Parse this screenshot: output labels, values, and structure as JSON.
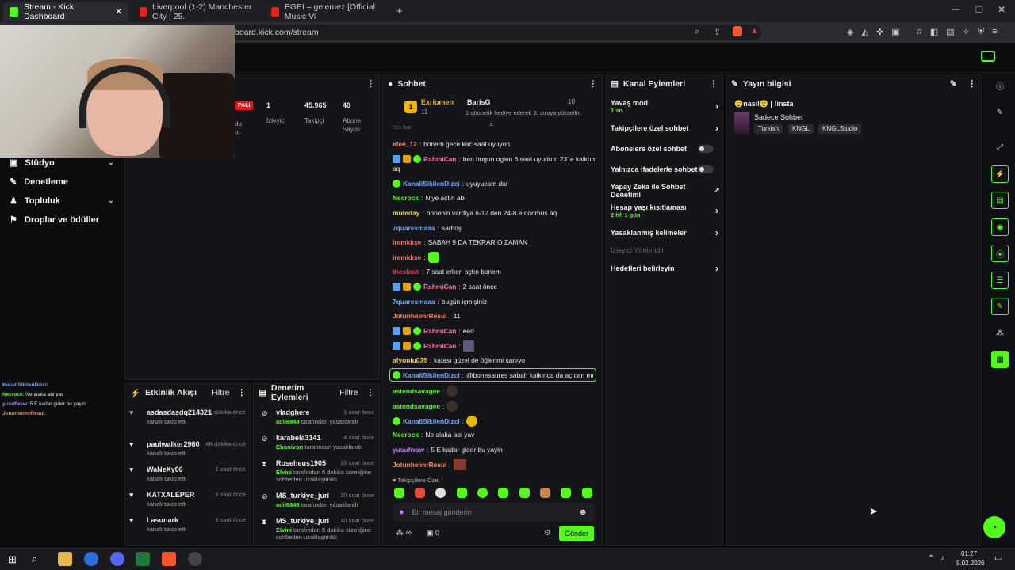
{
  "browser": {
    "tabs": [
      {
        "label": "Stream - Kick Dashboard"
      },
      {
        "label": "Liverpool (1-2) Manchester City | 25."
      },
      {
        "label": "EGEI – gelemez [Official Music Vi"
      }
    ],
    "url": "board.kick.com/stream"
  },
  "sidebar": {
    "items": [
      {
        "label": "Stüdyo"
      },
      {
        "label": "Denetleme"
      },
      {
        "label": "Topluluk"
      },
      {
        "label": "Droplar ve ödüller"
      }
    ]
  },
  "stats": {
    "live_badge": "PALI",
    "viewers_value": "1",
    "viewers_label": "İzleyici",
    "followers_value": "45.965",
    "followers_label": "Takipçi",
    "subs_value": "40",
    "subs_label_1": "Abone",
    "subs_label_2": "Sayısı",
    "cut_label": "du",
    "cut_label_2": "ın"
  },
  "chat": {
    "title": "Sohbet",
    "pinned": {
      "user1": "Exriomen",
      "user1_count": "11",
      "user2": "BarisG",
      "user2_count": "10",
      "note": "1 abonelik hediye ederek 3. sıraya yükseltin"
    },
    "partial_top": "Yes bar",
    "messages": [
      {
        "user": "efee_12",
        "text": "bonem gece kac saat uyuyon"
      },
      {
        "user": "RahmiCan",
        "text": "ben bugun oglen 6 saat uyudum 23'te kalktım"
      },
      {
        "user": "",
        "text": "aq"
      },
      {
        "user": "KanaliSikilenDizci",
        "text": "uyuyucam dur"
      },
      {
        "user": "Necrock",
        "text": "Niye açtın abi"
      },
      {
        "user": "muteday",
        "text": "bonenin vardiya 8-12 den 24-8 e dönmüş aq"
      },
      {
        "user": "7quaresmaaa",
        "text": "sarhoş"
      },
      {
        "user": "iremkkse",
        "text": "SABAH 9 DA TEKRAR O ZAMAN"
      },
      {
        "user": "iremkkse",
        "text": ""
      },
      {
        "user": "theslash",
        "text": "7 saat erken açtın bonem"
      },
      {
        "user": "RahmiCan",
        "text": "2 saat önce"
      },
      {
        "user": "7quaresmaaa",
        "text": "bugün içmişiniz"
      },
      {
        "user": "JotunheimrResul",
        "text": "11"
      },
      {
        "user": "RahmiCan",
        "text": "eed"
      },
      {
        "user": "RahmiCan",
        "text": ""
      },
      {
        "user": "afyonlu035",
        "text": "kafası güzel de öğlenmi sanıyo"
      },
      {
        "user": "KanaliSikilenDizci",
        "text": "@bonesaures sabah kalkınca da açıcan mı"
      },
      {
        "user": "astendsavagee",
        "text": ""
      },
      {
        "user": "astendsavagee",
        "text": ""
      },
      {
        "user": "KanaliSikilenDizci",
        "text": ""
      },
      {
        "user": "Necrock",
        "text": "Ne alaka abi yav"
      },
      {
        "user": "yusufwsw",
        "text": "5 E kadar gider bu yayin"
      },
      {
        "user": "JotunheimrResul",
        "text": ""
      }
    ],
    "followers_only": "Takipçilere Özel",
    "input_placeholder": "Bir mesaj gönderin",
    "infinity": "∞",
    "counter": "0",
    "send_label": "Gönder"
  },
  "channel_actions": {
    "title": "Kanal Eylemleri",
    "slow_mode": "Yavaş mod",
    "slow_mode_value": "1 sn.",
    "followers_chat": "Takipçilere özel sohbet",
    "subs_chat": "Abonelere özel sohbet",
    "emote_chat": "Yalnızca ifadelerle sohbet",
    "ai_chat": "Yapay Zeka ile Sohbet Denetimi",
    "age_limit": "Hesap yaşı kısıtlaması",
    "age_limit_value": "2 hf. 1 gün",
    "banned_words": "Yasaklanmış kelimeler",
    "redirect": "İzleyici Yönlendir",
    "goals": "Hedefleri belirleyin"
  },
  "stream_info": {
    "title": "Yayın bilgisi",
    "stream_title": "😮nasıl😮 | !insta",
    "category": "Sadece Sohbet",
    "tags": [
      "Turkish",
      "KNGL",
      "KNGLStudio"
    ]
  },
  "activity_feed": {
    "title": "Etkinlik Akışı",
    "filter": "Filtre",
    "items": [
      {
        "name": "asdasdasdq214321",
        "time": "1 dakika önce",
        "action": "kanalı takip etti"
      },
      {
        "name": "paulwalker2960",
        "time": "48 dakika önce",
        "action": "kanalı takip etti"
      },
      {
        "name": "WaNeXy06",
        "time": "2 saat önce",
        "action": "kanalı takip etti"
      },
      {
        "name": "KATXALEPER",
        "time": "5 saat önce",
        "action": "kanalı takip etti"
      },
      {
        "name": "Lasunark",
        "time": "5 saat önce",
        "action": "kanalı takip etti"
      }
    ]
  },
  "mod_actions": {
    "title": "Denetim Eylemleri",
    "filter": "Filtre",
    "items": [
      {
        "name": "vladghere",
        "time": "1 saat önce",
        "by": "adil6848",
        "action": "tarafından yasaklandı"
      },
      {
        "name": "karabela3141",
        "time": "4 saat önce",
        "by": "Ebonivon",
        "action": "tarafından yasaklandı"
      },
      {
        "name": "Roseheus1905",
        "time": "10 saat önce",
        "by": "Elvini",
        "action": "tarafından 5 dakika süreliğine sohbetten uzaklaştırıldı"
      },
      {
        "name": "MS_turkiye_juri",
        "time": "10 saat önce",
        "by": "adil6848",
        "action": "tarafından yasaklandı"
      },
      {
        "name": "MS_turkiye_juri",
        "time": "10 saat önce",
        "by": "Elvini",
        "action": "tarafından 5 dakika süreliğine sohbetten uzaklaştırıldı"
      }
    ]
  },
  "overlay_chat": [
    {
      "user": "KanaliSikilenDizci",
      "text": ":"
    },
    {
      "user": "Necrock",
      "text": ": Ne alaka abi yav"
    },
    {
      "user": "yusufwsw",
      "text": ": 5 E kadar gider bu yayin"
    },
    {
      "user": "JotunheimrResul",
      "text": ":"
    }
  ],
  "taskbar": {
    "time": "01:27",
    "date": "9.02.2026"
  },
  "colors": {
    "accent": "#53fc18",
    "panel": "#141519",
    "bg": "#0b0c0e"
  }
}
